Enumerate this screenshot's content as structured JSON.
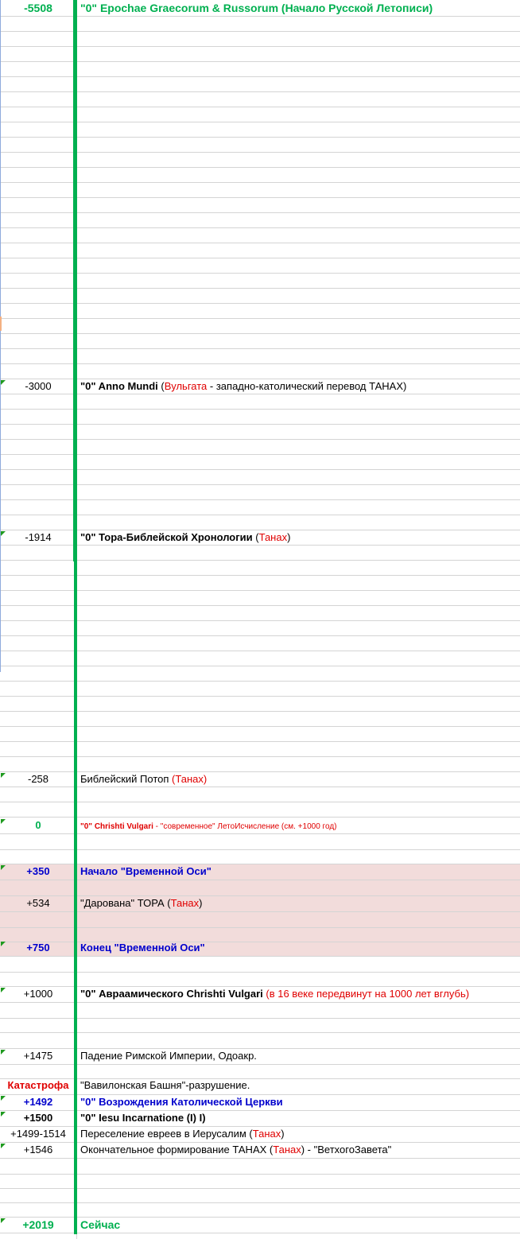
{
  "rows": [
    {
      "year": "-5508",
      "segments": [
        {
          "text": "\"0\" Epochae Graecorum & Russorum (Начало Русской Летописи)",
          "style": "green-bold"
        }
      ]
    },
    {
      "year": "-3000",
      "segments": [
        {
          "text": "\"0\" Anno Mundi",
          "style": "bold"
        },
        {
          "text": " (",
          "style": "normal"
        },
        {
          "text": "Вульгата",
          "style": "red"
        },
        {
          "text": " - западно-католический перевод ТАНАХ)",
          "style": "normal"
        }
      ]
    },
    {
      "year": "-1914",
      "segments": [
        {
          "text": "\"0\" Тора-Библейской Хронологии",
          "style": "bold"
        },
        {
          "text": " (",
          "style": "normal"
        },
        {
          "text": "Танах",
          "style": "red"
        },
        {
          "text": ")",
          "style": "normal"
        }
      ]
    },
    {
      "year": "-258",
      "segments": [
        {
          "text": "Библейский Потоп ",
          "style": "normal"
        },
        {
          "text": "(Танах)",
          "style": "red"
        }
      ]
    },
    {
      "year": "0",
      "segments": [
        {
          "text": "\"0\" Chrishti Vulgari",
          "style": "red-small-bold"
        },
        {
          "text": " - \"современное\" ЛетоИсчисление (см. +1000 год)",
          "style": "red-small"
        }
      ]
    },
    {
      "year": "+350",
      "segments": [
        {
          "text": "Начало \"Временной Оси\"",
          "style": "blue-bold"
        }
      ]
    },
    {
      "year": "+534",
      "segments": [
        {
          "text": "\"Дарована\" ТОРА (",
          "style": "normal"
        },
        {
          "text": "Танах",
          "style": "red"
        },
        {
          "text": ")",
          "style": "normal"
        }
      ]
    },
    {
      "year": "+750",
      "segments": [
        {
          "text": "Конец \"Временной Оси\"",
          "style": "blue-bold"
        }
      ]
    },
    {
      "year": "+1000",
      "segments": [
        {
          "text": "\"0\" Авраамического Chrishti Vulgari",
          "style": "bold"
        },
        {
          "text": " (в 16 веке передвинут на 1000 лет вглубь)",
          "style": "red"
        }
      ]
    },
    {
      "year": "+1475",
      "segments": [
        {
          "text": "Падение Римской Империи, Одоакр.",
          "style": "normal"
        }
      ]
    },
    {
      "year": "Катастрофа",
      "segments": [
        {
          "text": "\"Вавилонская Башня\"-разрушение.",
          "style": "normal"
        }
      ]
    },
    {
      "year": "+1492",
      "segments": [
        {
          "text": "\"0\" Возрождения Католической Церкви",
          "style": "blue-bold"
        }
      ]
    },
    {
      "year": "+1500",
      "segments": [
        {
          "text": "\"0\" Iesu Incarnatione (I) I)",
          "style": "bold"
        }
      ]
    },
    {
      "year": "+1499-1514",
      "segments": [
        {
          "text": "Переселение евреев в Иерусалим (",
          "style": "normal"
        },
        {
          "text": "Танах",
          "style": "red"
        },
        {
          "text": ")",
          "style": "normal"
        }
      ]
    },
    {
      "year": "+1546",
      "segments": [
        {
          "text": "Окончательное формирование ТАНАХ (",
          "style": "normal"
        },
        {
          "text": "Танах",
          "style": "red"
        },
        {
          "text": ") - \"ВетхогоЗавета\"",
          "style": "normal"
        }
      ]
    },
    {
      "year": "+2019",
      "segments": [
        {
          "text": "Сейчас",
          "style": "green-bold"
        }
      ]
    }
  ],
  "colors": {
    "accent_green": "#00b050",
    "highlight_band": "#f2dcdb",
    "emphasis_blue": "#0000cc",
    "note_red": "#e00000"
  }
}
